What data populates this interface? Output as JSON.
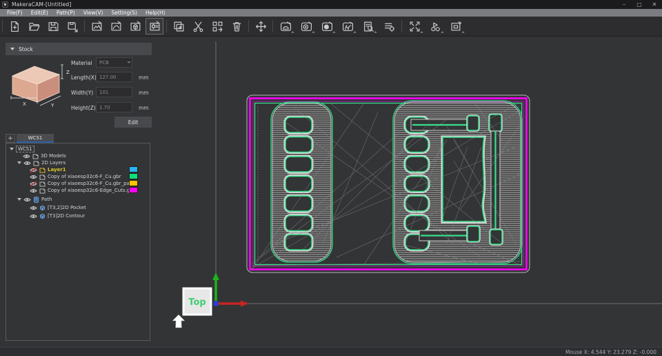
{
  "window": {
    "title": "MakeraCAM-[Untitled]",
    "controls": {
      "minimize": "–",
      "maximize": "▢",
      "close": "✕"
    }
  },
  "menu": {
    "items": [
      "File(F)",
      "Edit(E)",
      "Path(P)",
      "View(V)",
      "Setting(S)",
      "Help(H)"
    ]
  },
  "toolbar": {
    "icons": [
      "new-file",
      "open-file",
      "save",
      "save-as",
      "import-image",
      "import-vector",
      "import-3d-model",
      "import-gerber",
      "copy",
      "cut",
      "array",
      "delete",
      "transform-move",
      "new-pocket-operation",
      "new-contour-operation",
      "new-drill-operation",
      "new-engrave-operation",
      "preview-toolpath",
      "post-process-list",
      "fit-view",
      "simulate",
      "screenshot"
    ],
    "selected_icon": "import-gerber"
  },
  "stock": {
    "header": "Stock",
    "material_label": "Material",
    "material_value": "PCB",
    "length_label": "Length(X)",
    "length_value": "127.00",
    "width_label": "Width(Y)",
    "width_value": "101",
    "height_label": "Height(Z)",
    "height_value": "1.70",
    "unit_mm": "mm",
    "edit_label": "Edit",
    "axis_labels": {
      "x": "X",
      "y": "Y",
      "z": "Z"
    }
  },
  "tree": {
    "add_tab_label": "+",
    "tab_label": "WCS1",
    "root_label": "WCS1",
    "items": [
      {
        "label": "3D Models",
        "eye": "on",
        "icon": "layers"
      },
      {
        "label": "2D Layers",
        "eye": "on",
        "icon": "layers"
      },
      {
        "label": "Layer1",
        "eye": "off",
        "icon": "layer",
        "swatch": "#29b6f0",
        "highlighted": true
      },
      {
        "label": "Copy of xiaoesp32c6-F_Cu.gbr",
        "eye": "on",
        "icon": "layer",
        "swatch": "#0ce07c"
      },
      {
        "label": "Copy of xiaoesp32c6-F_Cu.gbr_pad",
        "eye": "off",
        "icon": "layer",
        "swatch": "#ffc400"
      },
      {
        "label": "Copy of xiaoesp32c6-Edge_Cuts.gbr",
        "eye": "on",
        "icon": "layer",
        "swatch": "#ff00f0"
      },
      {
        "label": "Path",
        "eye": "on",
        "icon": "path"
      },
      {
        "label": "[T3,2]2D Pocket",
        "eye": "on",
        "icon": "toolpath"
      },
      {
        "label": "[T3]2D Contour",
        "eye": "on",
        "icon": "toolpath"
      }
    ]
  },
  "viewport": {
    "view_label": "Top"
  },
  "status": {
    "mouse": "Mouse X: 4.544 Y: 23.279 Z: -0.000"
  },
  "colors": {
    "accent_blue": "#2d5ea8",
    "pcb_green": "#35e08a",
    "edge_magenta": "#ff00ff",
    "hatch_gray": "#c3c3c3",
    "axis_red": "#c42525",
    "axis_green": "#1db31d",
    "axis_blue": "#2c3ed0",
    "canvas_bg": "#333436",
    "eye_slash_red": "#d03030"
  }
}
